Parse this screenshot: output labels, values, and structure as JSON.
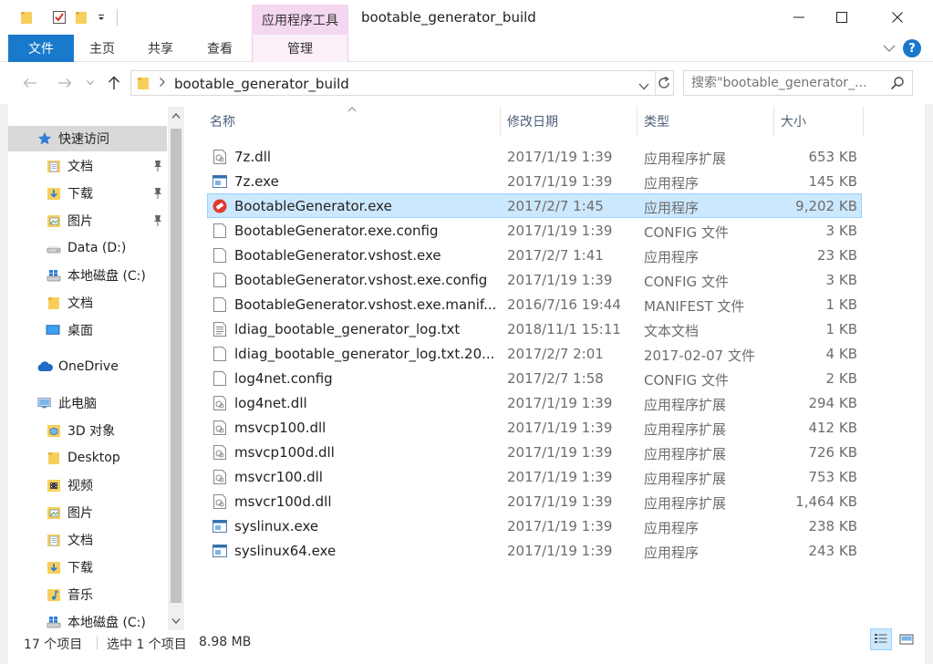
{
  "window": {
    "title": "bootable_generator_build",
    "tool_tab": "应用程序工具",
    "colors": {
      "accent": "#1979ca",
      "tool_tab_bg": "#f5d7f1",
      "selection": "#cce8ff"
    }
  },
  "ribbon": {
    "tabs": [
      "文件",
      "主页",
      "共享",
      "查看",
      "管理"
    ]
  },
  "address": {
    "path": "bootable_generator_build",
    "search_placeholder": "搜索\"bootable_generator_..."
  },
  "nav": {
    "quick_access": "快速访问",
    "items": [
      {
        "label": "文档",
        "icon": "documents-icon",
        "pinned": true
      },
      {
        "label": "下载",
        "icon": "downloads-icon",
        "pinned": true
      },
      {
        "label": "图片",
        "icon": "pictures-icon",
        "pinned": true
      },
      {
        "label": "Data (D:)",
        "icon": "drive-icon",
        "pinned": false
      },
      {
        "label": "本地磁盘 (C:)",
        "icon": "windows-drive-icon",
        "pinned": false
      },
      {
        "label": "文档",
        "icon": "folder-icon",
        "pinned": false
      },
      {
        "label": "桌面",
        "icon": "desktop-icon",
        "pinned": false
      }
    ],
    "onedrive": "OneDrive",
    "this_pc": "此电脑",
    "pc_items": [
      {
        "label": "3D 对象",
        "icon": "3d-objects-icon"
      },
      {
        "label": "Desktop",
        "icon": "folder-icon"
      },
      {
        "label": "视频",
        "icon": "videos-icon"
      },
      {
        "label": "图片",
        "icon": "pictures-icon"
      },
      {
        "label": "文档",
        "icon": "documents-icon"
      },
      {
        "label": "下载",
        "icon": "downloads-icon"
      },
      {
        "label": "音乐",
        "icon": "music-icon"
      },
      {
        "label": "本地磁盘 (C:)",
        "icon": "windows-drive-icon"
      }
    ]
  },
  "columns": {
    "name": "名称",
    "date": "修改日期",
    "type": "类型",
    "size": "大小"
  },
  "files": [
    {
      "name": "7z.dll",
      "date": "2017/1/19 1:39",
      "type": "应用程序扩展",
      "size": "653 KB",
      "icon": "dll-icon"
    },
    {
      "name": "7z.exe",
      "date": "2017/1/19 1:39",
      "type": "应用程序",
      "size": "145 KB",
      "icon": "exe-icon"
    },
    {
      "name": "BootableGenerator.exe",
      "date": "2017/2/7 1:45",
      "type": "应用程序",
      "size": "9,202 KB",
      "icon": "bootable-app-icon",
      "selected": true
    },
    {
      "name": "BootableGenerator.exe.config",
      "date": "2017/1/19 1:39",
      "type": "CONFIG 文件",
      "size": "3 KB",
      "icon": "file-icon"
    },
    {
      "name": "BootableGenerator.vshost.exe",
      "date": "2017/2/7 1:41",
      "type": "应用程序",
      "size": "23 KB",
      "icon": "file-icon"
    },
    {
      "name": "BootableGenerator.vshost.exe.config",
      "date": "2017/1/19 1:39",
      "type": "CONFIG 文件",
      "size": "3 KB",
      "icon": "file-icon"
    },
    {
      "name": "BootableGenerator.vshost.exe.manif...",
      "date": "2016/7/16 19:44",
      "type": "MANIFEST 文件",
      "size": "1 KB",
      "icon": "file-icon"
    },
    {
      "name": "ldiag_bootable_generator_log.txt",
      "date": "2018/11/1 15:11",
      "type": "文本文档",
      "size": "1 KB",
      "icon": "text-file-icon"
    },
    {
      "name": "ldiag_bootable_generator_log.txt.20...",
      "date": "2017/2/7 2:01",
      "type": "2017-02-07 文件",
      "size": "4 KB",
      "icon": "file-icon"
    },
    {
      "name": "log4net.config",
      "date": "2017/2/7 1:58",
      "type": "CONFIG 文件",
      "size": "2 KB",
      "icon": "file-icon"
    },
    {
      "name": "log4net.dll",
      "date": "2017/1/19 1:39",
      "type": "应用程序扩展",
      "size": "294 KB",
      "icon": "dll-icon"
    },
    {
      "name": "msvcp100.dll",
      "date": "2017/1/19 1:39",
      "type": "应用程序扩展",
      "size": "412 KB",
      "icon": "dll-icon"
    },
    {
      "name": "msvcp100d.dll",
      "date": "2017/1/19 1:39",
      "type": "应用程序扩展",
      "size": "726 KB",
      "icon": "dll-icon"
    },
    {
      "name": "msvcr100.dll",
      "date": "2017/1/19 1:39",
      "type": "应用程序扩展",
      "size": "753 KB",
      "icon": "dll-icon"
    },
    {
      "name": "msvcr100d.dll",
      "date": "2017/1/19 1:39",
      "type": "应用程序扩展",
      "size": "1,464 KB",
      "icon": "dll-icon"
    },
    {
      "name": "syslinux.exe",
      "date": "2017/1/19 1:39",
      "type": "应用程序",
      "size": "238 KB",
      "icon": "exe-icon"
    },
    {
      "name": "syslinux64.exe",
      "date": "2017/1/19 1:39",
      "type": "应用程序",
      "size": "243 KB",
      "icon": "exe-icon"
    }
  ],
  "status": {
    "count": "17 个项目",
    "selected": "选中 1 个项目",
    "size": "8.98 MB"
  }
}
